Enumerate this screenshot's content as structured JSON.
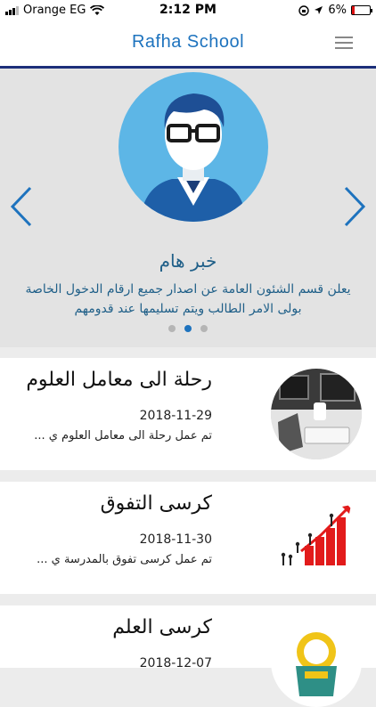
{
  "status": {
    "carrier": "Orange EG",
    "time": "2:12 PM",
    "battery": "6%"
  },
  "app": {
    "title": "Rafha School"
  },
  "slider": {
    "title": "خبر هام",
    "text": "يعلن قسم الشئون العامة عن اصدار جميع ارقام الدخول الخاصة بولى الامر الطالب ويتم تسليمها عند قدومهم",
    "dots": 3,
    "active_dot": 1
  },
  "news": [
    {
      "title": "رحلة الى معامل العلوم",
      "date": "2018-11-29",
      "desc": "تم عمل رحلة الى معامل العلوم ي ..."
    },
    {
      "title": "كرسى التفوق",
      "date": "2018-11-30",
      "desc": "تم عمل كرسى تفوق بالمدرسة ي ..."
    },
    {
      "title": "كرسى العلم",
      "date": "2018-12-07",
      "desc": ""
    }
  ],
  "colors": {
    "accent": "#1e73be",
    "navy": "#1c2f7a",
    "text_blue": "#1f5f88"
  }
}
